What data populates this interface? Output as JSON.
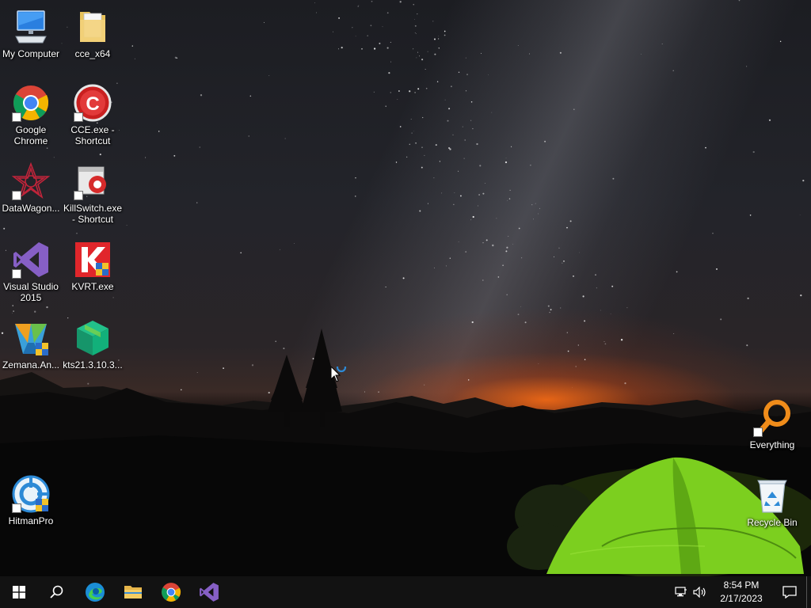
{
  "desktop": {
    "icons": [
      {
        "label": "My Computer",
        "icon": "computer-icon"
      },
      {
        "label": "cce_x64",
        "icon": "folder-icon"
      },
      {
        "label": "Google Chrome",
        "icon": "chrome-icon",
        "shortcut": true
      },
      {
        "label": "CCE.exe - Shortcut",
        "icon": "cce-icon",
        "shortcut": true
      },
      {
        "label": "DataWagon...",
        "icon": "datawagon-icon",
        "shortcut": true
      },
      {
        "label": "KillSwitch.exe - Shortcut",
        "icon": "killswitch-icon",
        "shortcut": true
      },
      {
        "label": "Visual Studio 2015",
        "icon": "visual-studio-icon",
        "shortcut": true
      },
      {
        "label": "KVRT.exe",
        "icon": "kvrt-icon"
      },
      {
        "label": "Zemana.An...",
        "icon": "zemana-icon"
      },
      {
        "label": "kts21.3.10.3...",
        "icon": "kts-package-icon"
      },
      {
        "label": "HitmanPro",
        "icon": "hitmanpro-icon",
        "shortcut": true
      },
      {
        "label": "Everything",
        "icon": "everything-icon",
        "shortcut": true
      },
      {
        "label": "Recycle Bin",
        "icon": "recycle-bin-icon"
      }
    ]
  },
  "taskbar": {
    "buttons": [
      {
        "name": "start-button",
        "icon": "windows-logo-icon"
      },
      {
        "name": "search-button",
        "icon": "search-icon"
      },
      {
        "name": "edge-button",
        "icon": "edge-icon"
      },
      {
        "name": "file-explorer-button",
        "icon": "folder-icon"
      },
      {
        "name": "chrome-button",
        "icon": "chrome-icon"
      },
      {
        "name": "visual-studio-button",
        "icon": "visual-studio-icon"
      }
    ],
    "tray": {
      "time": "8:54 PM",
      "date": "2/17/2023",
      "icons": [
        "network-icon",
        "volume-icon",
        "notification-icon"
      ]
    }
  },
  "colors": {
    "taskbar_bg": "#121212",
    "chrome_red": "#db4437",
    "chrome_green": "#0f9d58",
    "chrome_yellow": "#f4b400",
    "chrome_blue": "#4285f4",
    "vs_purple": "#865fc5",
    "tent_green": "#7ccf1f",
    "everything_orange": "#f08c1a"
  }
}
